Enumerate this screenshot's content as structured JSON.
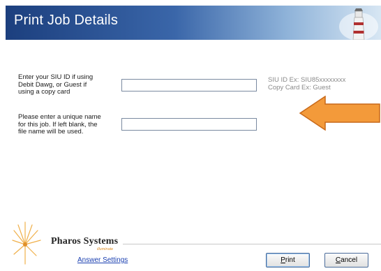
{
  "header": {
    "title": "Print Job Details"
  },
  "form": {
    "siu_label": [
      "Enter your SIU ID if using",
      "Debit Dawg, or Guest if",
      "using a copy card"
    ],
    "siu_value": "",
    "job_label": [
      "Please enter a unique name",
      "for this job. If left blank, the",
      "file name will be used."
    ],
    "job_value": ""
  },
  "hints": [
    "SIU ID Ex: SIU85xxxxxxxx",
    "Copy Card Ex: Guest"
  ],
  "annotation": {
    "arrow_color": "#f39a3a",
    "arrow_border": "#c8691a",
    "direction": "left"
  },
  "footer": {
    "brand": "Pharos Systems",
    "brand_sub": "illuminate",
    "answer_settings": "Answer Settings",
    "print_access": "P",
    "print_rest": "rint",
    "cancel_access": "C",
    "cancel_rest": "ancel"
  },
  "colors": {
    "header_start": "#1c3f7e",
    "header_end": "#d7e6f3",
    "link": "#1a3fb0"
  }
}
